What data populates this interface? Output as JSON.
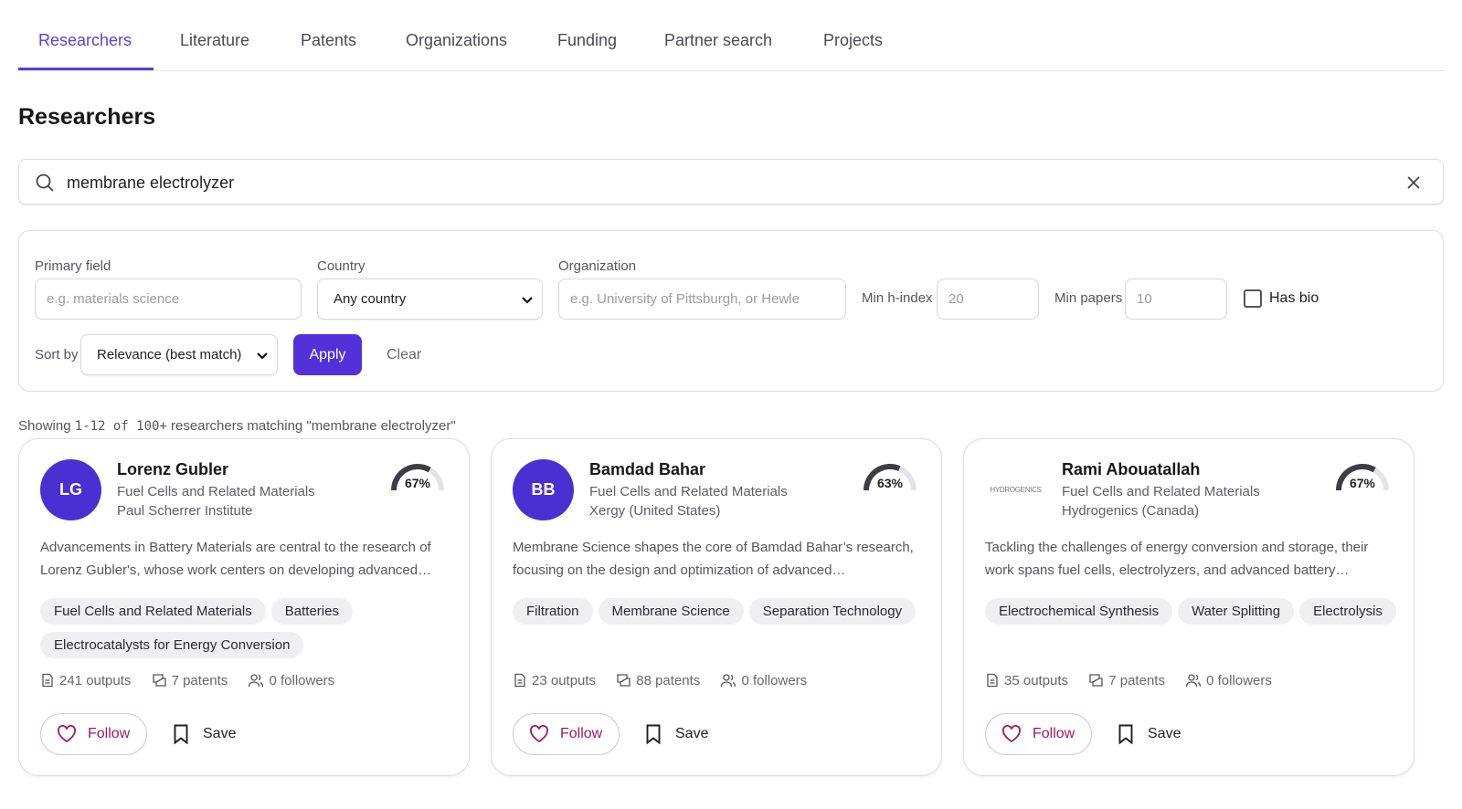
{
  "tabs": [
    {
      "label": "Researchers",
      "active": true
    },
    {
      "label": "Literature"
    },
    {
      "label": "Patents"
    },
    {
      "label": "Organizations"
    },
    {
      "label": "Funding"
    },
    {
      "label": "Partner search"
    },
    {
      "label": "Projects"
    }
  ],
  "page_title": "Researchers",
  "search": {
    "value": "membrane electrolyzer"
  },
  "filters": {
    "primary_field_label": "Primary field",
    "primary_field_placeholder": "e.g. materials science",
    "country_label": "Country",
    "country_value": "Any country",
    "organization_label": "Organization",
    "organization_placeholder": "e.g. University of Pittsburgh, or Hewle",
    "min_hindex_label": "Min h-index",
    "min_hindex_placeholder": "20",
    "min_papers_label": "Min papers",
    "min_papers_placeholder": "10",
    "has_bio_label": "Has bio",
    "sort_label": "Sort by",
    "sort_value": "Relevance (best match)",
    "apply_label": "Apply",
    "clear_label": "Clear"
  },
  "results": {
    "prefix": "Showing ",
    "range": "1-12 of 100+",
    "suffix": " researchers matching \"membrane electrolyzer\""
  },
  "accent_color": "#5331d8",
  "cards": [
    {
      "initials": "LG",
      "name": "Lorenz Gubler",
      "field": "Fuel Cells and Related Materials",
      "org": "Paul Scherrer Institute",
      "match": "67%",
      "match_fraction": 0.67,
      "desc": "Advancements in Battery Materials are central to the research of Lorenz Gubler's, whose work centers on developing advanced…",
      "tags": [
        "Fuel Cells and Related Materials",
        "Batteries",
        "Electrocatalysts for Energy Conversion"
      ],
      "outputs": "241 outputs",
      "patents": "7 patents",
      "followers": "0 followers",
      "follow_label": "Follow",
      "save_label": "Save"
    },
    {
      "initials": "BB",
      "name": "Bamdad Bahar",
      "field": "Fuel Cells and Related Materials",
      "org": "Xergy (United States)",
      "match": "63%",
      "match_fraction": 0.63,
      "desc": "Membrane Science shapes the core of Bamdad Bahar’s research, focusing on the design and optimization of advanced…",
      "tags": [
        "Filtration",
        "Membrane Science",
        "Separation Technology"
      ],
      "outputs": "23 outputs",
      "patents": "88 patents",
      "followers": "0 followers",
      "follow_label": "Follow",
      "save_label": "Save"
    },
    {
      "logo_text": "HYDROGENICS",
      "name": "Rami Abouatallah",
      "field": "Fuel Cells and Related Materials",
      "org": "Hydrogenics (Canada)",
      "match": "67%",
      "match_fraction": 0.67,
      "desc": "Tackling the challenges of energy conversion and storage, their work spans fuel cells, electrolyzers, and advanced battery…",
      "tags": [
        "Electrochemical Synthesis",
        "Water Splitting",
        "Electrolysis"
      ],
      "outputs": "35 outputs",
      "patents": "7 patents",
      "followers": "0 followers",
      "follow_label": "Follow",
      "save_label": "Save"
    }
  ]
}
